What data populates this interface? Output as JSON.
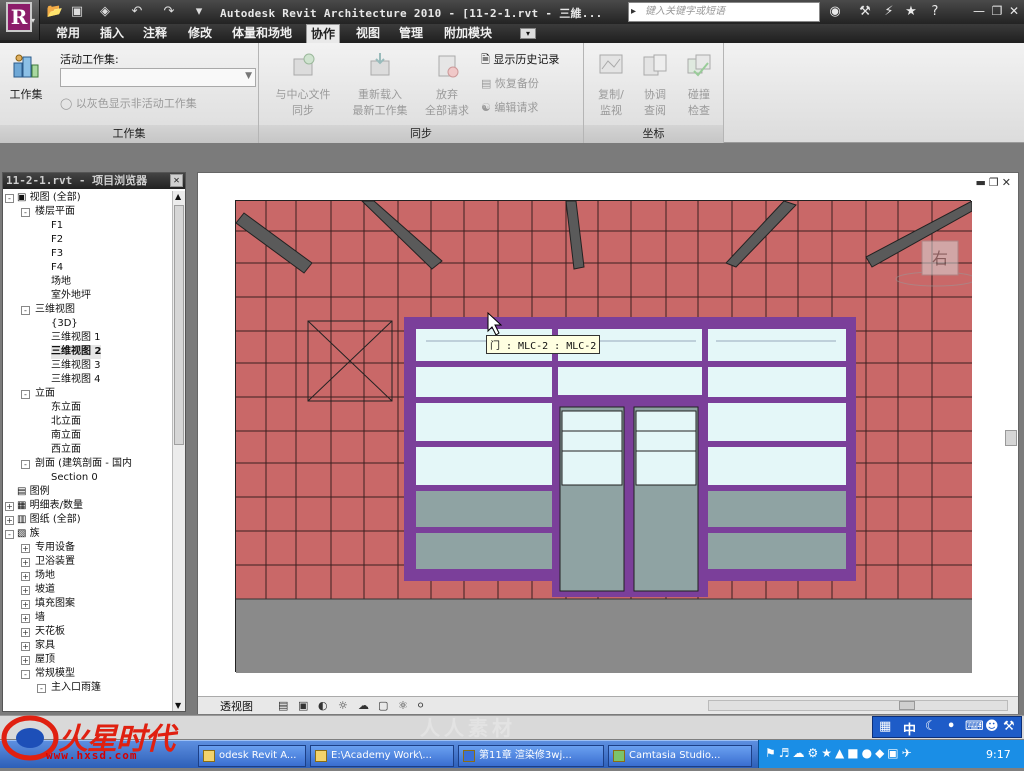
{
  "titlebar": {
    "title": "Autodesk Revit Architecture 2010 - [11-2-1.rvt - 三維...",
    "search_placeholder": "键入关键字或短语"
  },
  "ribbon_tabs": [
    "常用",
    "插入",
    "注释",
    "修改",
    "体量和场地",
    "协作",
    "视图",
    "管理",
    "附加模块"
  ],
  "active_tab": "协作",
  "ribbon": {
    "worksets_panel": {
      "worksets_button": "工作集",
      "active_workset_label": "活动工作集:",
      "gray_inactive": "以灰色显示非活动工作集",
      "footer": "工作集"
    },
    "sync_panel": {
      "sync_central": [
        "与中心文件",
        "同步"
      ],
      "reload_latest": [
        "重新载入",
        "最新工作集"
      ],
      "relinquish_all": [
        "放弃",
        "全部请求"
      ],
      "show_history": "显示历史记录",
      "restore_backup": "恢复备份",
      "edit_requests": "编辑请求",
      "footer": "同步"
    },
    "coord_panel": {
      "copy_monitor": [
        "复制/",
        "监视"
      ],
      "coord_review": [
        "协调",
        "查阅"
      ],
      "interference": [
        "碰撞",
        "检查"
      ],
      "footer": "坐标"
    }
  },
  "project_browser": {
    "title": "11-2-1.rvt - 项目浏览器",
    "tree": [
      {
        "label": "视图 (全部)",
        "level": 0,
        "toggle": "-",
        "icon": "views"
      },
      {
        "label": "楼层平面",
        "level": 1,
        "toggle": "-"
      },
      {
        "label": "F1",
        "level": 2
      },
      {
        "label": "F2",
        "level": 2
      },
      {
        "label": "F3",
        "level": 2
      },
      {
        "label": "F4",
        "level": 2
      },
      {
        "label": "场地",
        "level": 2
      },
      {
        "label": "室外地坪",
        "level": 2
      },
      {
        "label": "三维视图",
        "level": 1,
        "toggle": "-"
      },
      {
        "label": "{3D}",
        "level": 2
      },
      {
        "label": "三维视图 1",
        "level": 2
      },
      {
        "label": "三维视图 2",
        "level": 2,
        "selected": true
      },
      {
        "label": "三维视图 3",
        "level": 2
      },
      {
        "label": "三维视图 4",
        "level": 2
      },
      {
        "label": "立面",
        "level": 1,
        "toggle": "-"
      },
      {
        "label": "东立面",
        "level": 2
      },
      {
        "label": "北立面",
        "level": 2
      },
      {
        "label": "南立面",
        "level": 2
      },
      {
        "label": "西立面",
        "level": 2
      },
      {
        "label": "剖面 (建筑剖面 - 国内",
        "level": 1,
        "toggle": "-"
      },
      {
        "label": "Section 0",
        "level": 2
      },
      {
        "label": "图例",
        "level": 0,
        "icon": "legend"
      },
      {
        "label": "明细表/数量",
        "level": 0,
        "toggle": "+",
        "icon": "schedule"
      },
      {
        "label": "图纸 (全部)",
        "level": 0,
        "toggle": "+",
        "icon": "sheet"
      },
      {
        "label": "族",
        "level": 0,
        "toggle": "-",
        "icon": "family"
      },
      {
        "label": "专用设备",
        "level": 1,
        "toggle": "+"
      },
      {
        "label": "卫浴装置",
        "level": 1,
        "toggle": "+"
      },
      {
        "label": "场地",
        "level": 1,
        "toggle": "+"
      },
      {
        "label": "坡道",
        "level": 1,
        "toggle": "+"
      },
      {
        "label": "填充图案",
        "level": 1,
        "toggle": "+"
      },
      {
        "label": "墙",
        "level": 1,
        "toggle": "+"
      },
      {
        "label": "天花板",
        "level": 1,
        "toggle": "+"
      },
      {
        "label": "家具",
        "level": 1,
        "toggle": "+"
      },
      {
        "label": "屋顶",
        "level": 1,
        "toggle": "+"
      },
      {
        "label": "常规模型",
        "level": 1,
        "toggle": "-"
      },
      {
        "label": "主入口雨篷",
        "level": 2,
        "toggle": "-"
      }
    ]
  },
  "view": {
    "tooltip": "门 : MLC-2 : MLC-2",
    "view_name": "透视图",
    "viewcube_label": "右",
    "colors": {
      "wall": "#c96868",
      "frame": "#7b3f9a",
      "glass": "#e4f7f8",
      "floor": "#8a8a8a",
      "door_lower": "#8fa3a3"
    }
  },
  "imebar": {
    "mode": "中"
  },
  "taskbar": {
    "items": [
      "odesk Revit A...",
      "E:\\Academy Work\\...",
      "第11章 渲染修3wj...",
      "Camtasia Studio..."
    ],
    "clock": "9:17"
  },
  "brand": {
    "name": "火星时代",
    "url": "www.hxsd.com",
    "watermark": "人人素材"
  }
}
